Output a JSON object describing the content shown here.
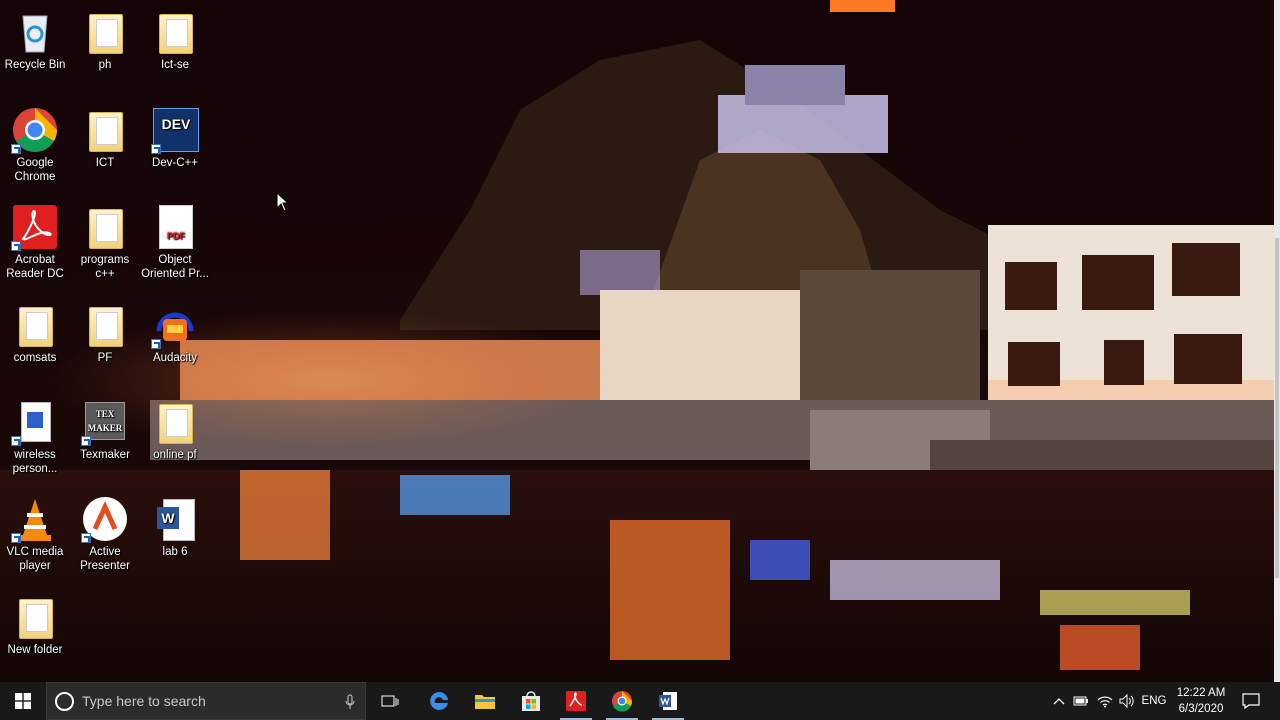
{
  "desktop": {
    "icons": [
      {
        "label": "Recycle Bin",
        "icon": "recycle-bin-icon"
      },
      {
        "label": "ph",
        "icon": "folder-icon"
      },
      {
        "label": "Ict-se",
        "icon": "folder-icon"
      },
      {
        "label": "Google Chrome",
        "icon": "chrome-icon"
      },
      {
        "label": "ICT",
        "icon": "folder-icon"
      },
      {
        "label": "Dev-C++",
        "icon": "devcpp-icon"
      },
      {
        "label": "Acrobat Reader DC",
        "icon": "acrobat-icon"
      },
      {
        "label": "programs c++",
        "icon": "folder-icon"
      },
      {
        "label": "Object Oriented Pr...",
        "icon": "pdf-file-icon"
      },
      {
        "label": "comsats",
        "icon": "folder-icon"
      },
      {
        "label": "PF",
        "icon": "folder-icon"
      },
      {
        "label": "Audacity",
        "icon": "audacity-icon"
      },
      {
        "label": "wireless person...",
        "icon": "document-icon"
      },
      {
        "label": "Texmaker",
        "icon": "texmaker-icon"
      },
      {
        "label": "online pf",
        "icon": "folder-icon"
      },
      {
        "label": "VLC media player",
        "icon": "vlc-icon"
      },
      {
        "label": "Active Presenter",
        "icon": "activepresenter-icon"
      },
      {
        "label": "lab 6",
        "icon": "word-document-icon"
      },
      {
        "label": "New folder",
        "icon": "folder-icon"
      }
    ],
    "devcpp_badge": "DEV",
    "pdf_badge": "PDF",
    "texmaker_badge": "TEX MAKER",
    "word_badge": "W"
  },
  "taskbar": {
    "search_placeholder": "Type here to search",
    "pinned": [
      "edge-icon",
      "file-explorer-icon",
      "store-icon",
      "acrobat-icon",
      "chrome-icon",
      "word-icon"
    ],
    "tray": {
      "language": "ENG",
      "time": "12:22 AM",
      "date": "6/3/2020"
    }
  },
  "colors": {
    "taskbar": "#191919",
    "accent": "#9bb8e0"
  }
}
